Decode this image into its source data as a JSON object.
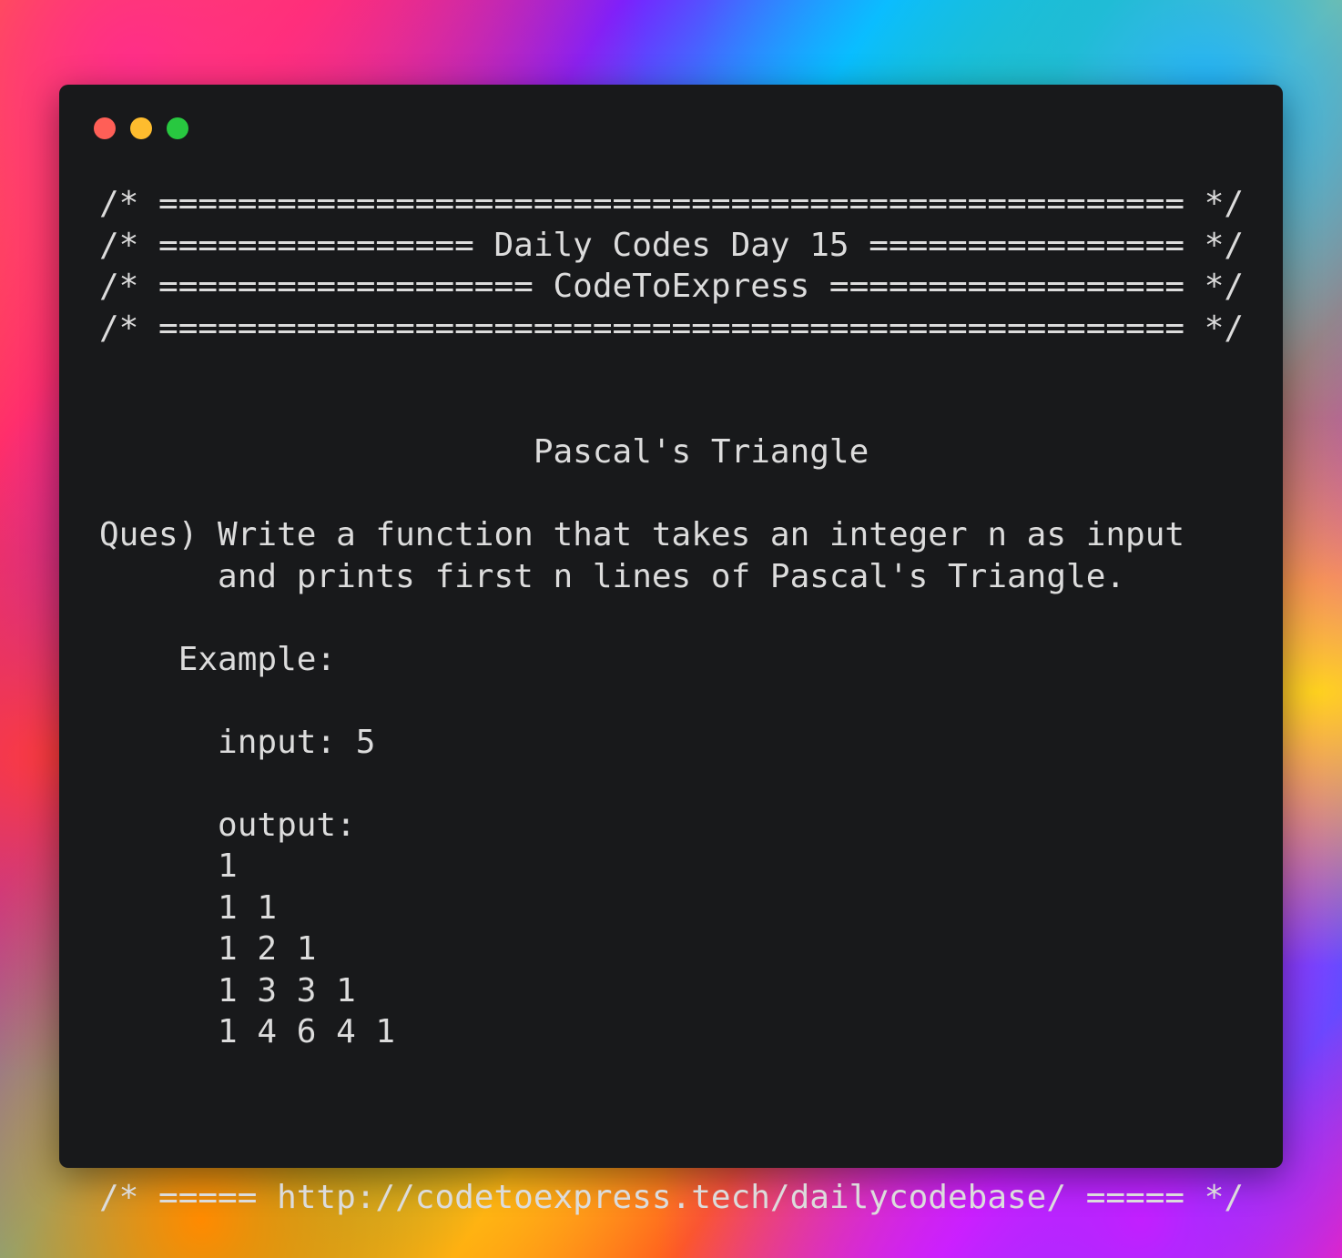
{
  "window": {
    "controls": [
      {
        "name": "close",
        "color": "#ff5f57"
      },
      {
        "name": "minimize",
        "color": "#febc2e"
      },
      {
        "name": "maximize",
        "color": "#28c840"
      }
    ]
  },
  "code_lines": [
    "/* ==================================================== */",
    "/* ================ Daily Codes Day 15 ================ */",
    "/* =================== CodeToExpress ================== */",
    "/* ==================================================== */",
    "",
    "",
    "                      Pascal's Triangle",
    "",
    "Ques) Write a function that takes an integer n as input",
    "      and prints first n lines of Pascal's Triangle.",
    "",
    "    Example:",
    "",
    "      input: 5",
    "",
    "      output:",
    "      1",
    "      1 1",
    "      1 2 1",
    "      1 3 3 1",
    "      1 4 6 4 1",
    "",
    "",
    "",
    "/* ===== http://codetoexpress.tech/dailycodebase/ ===== */"
  ]
}
